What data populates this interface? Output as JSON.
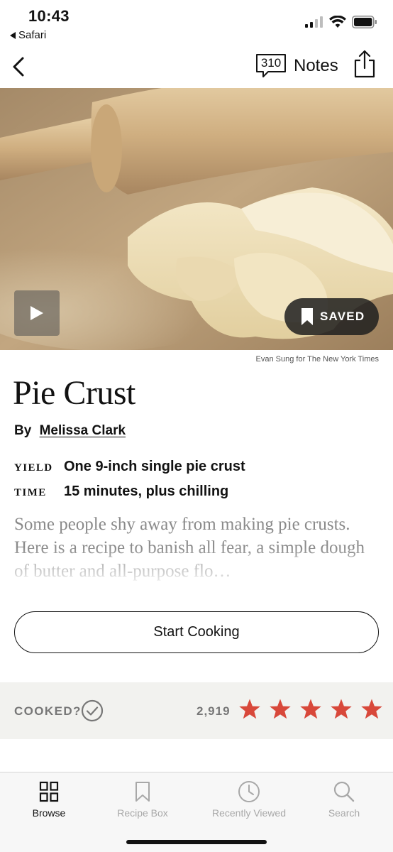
{
  "status_bar": {
    "time": "10:43",
    "back_app": "Safari",
    "icons": [
      "signal-icon",
      "wifi-icon",
      "battery-icon"
    ]
  },
  "nav": {
    "notes_count": "310",
    "notes_label": "Notes",
    "icons": [
      "chevron-left-icon",
      "comment-bubble-icon",
      "share-icon"
    ]
  },
  "hero": {
    "saved_label": "SAVED",
    "photo_credit": "Evan Sung for The New York Times",
    "icons": [
      "play-icon",
      "bookmark-icon"
    ]
  },
  "recipe": {
    "title": "Pie Crust",
    "by_prefix": "By",
    "author": "Melissa Clark",
    "yield_key": "YIELD",
    "yield_value": "One 9-inch single pie crust",
    "time_key": "TIME",
    "time_value": "15 minutes, plus chilling",
    "summary": "Some people shy away from making pie crusts. Here is a recipe to banish all fear, a simple dough of butter and all-purpose flo…"
  },
  "actions": {
    "start_cooking": "Start Cooking"
  },
  "cooked": {
    "label": "COOKED?",
    "rating_count": "2,919",
    "stars": 5,
    "star_color": "#d8483a"
  },
  "tabbar": {
    "tabs": [
      {
        "label": "Browse",
        "icon": "grid-icon",
        "active": true
      },
      {
        "label": "Recipe Box",
        "icon": "bookmark-outline-icon",
        "active": false
      },
      {
        "label": "Recently Viewed",
        "icon": "clock-icon",
        "active": false
      },
      {
        "label": "Search",
        "icon": "search-icon",
        "active": false
      }
    ]
  }
}
